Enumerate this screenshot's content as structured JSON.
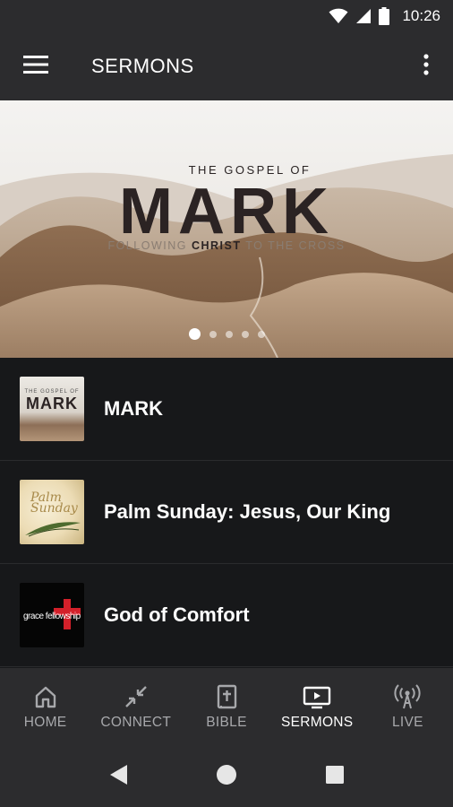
{
  "status_bar": {
    "time": "10:26"
  },
  "app_bar": {
    "title": "SERMONS"
  },
  "hero": {
    "eyebrow": "THE GOSPEL OF",
    "headline": "MARK",
    "tagline_pre": "FOLLOWING ",
    "tagline_bold": "CHRIST",
    "tagline_post": " TO THE CROSS",
    "active_slide": 1,
    "slide_count": 5
  },
  "thumbnails": {
    "mark_small": "THE GOSPEL OF",
    "mark_title": "MARK",
    "palm_script": "Palm Sunday",
    "grace_word": "grace fellowship"
  },
  "list": [
    {
      "label": "MARK",
      "thumb": "mark"
    },
    {
      "label": "Palm Sunday: Jesus, Our King",
      "thumb": "palm"
    },
    {
      "label": "God of Comfort",
      "thumb": "grace"
    }
  ],
  "bottom_nav": [
    {
      "label": "HOME",
      "icon": "home-icon",
      "active": false
    },
    {
      "label": "CONNECT",
      "icon": "connect-icon",
      "active": false
    },
    {
      "label": "BIBLE",
      "icon": "bible-icon",
      "active": false
    },
    {
      "label": "SERMONS",
      "icon": "video-icon",
      "active": true
    },
    {
      "label": "LIVE",
      "icon": "broadcast-icon",
      "active": false
    }
  ]
}
